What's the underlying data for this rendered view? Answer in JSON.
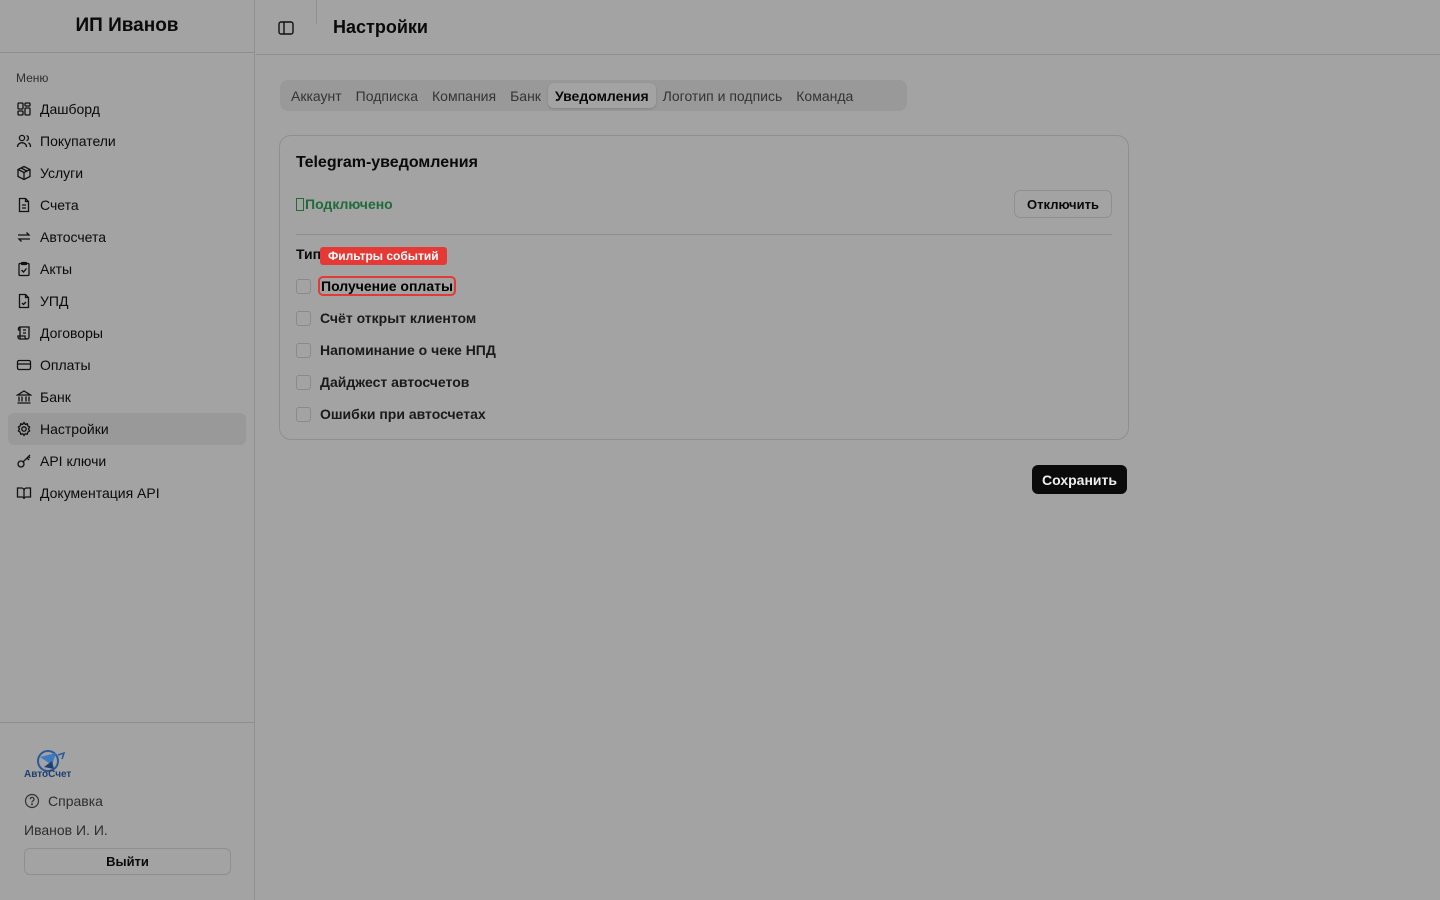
{
  "sidebar": {
    "brand": "ИП Иванов",
    "menu_label": "Меню",
    "items": [
      {
        "label": "Дашборд",
        "icon": "dashboard-icon"
      },
      {
        "label": "Покупатели",
        "icon": "users-icon"
      },
      {
        "label": "Услуги",
        "icon": "package-icon"
      },
      {
        "label": "Счета",
        "icon": "file-icon"
      },
      {
        "label": "Автосчета",
        "icon": "repeat-icon"
      },
      {
        "label": "Акты",
        "icon": "clipboard-check-icon"
      },
      {
        "label": "УПД",
        "icon": "file-check-icon"
      },
      {
        "label": "Договоры",
        "icon": "scroll-icon"
      },
      {
        "label": "Оплаты",
        "icon": "credit-card-icon"
      },
      {
        "label": "Банк",
        "icon": "bank-icon"
      },
      {
        "label": "Настройки",
        "icon": "gear-icon"
      },
      {
        "label": "API ключи",
        "icon": "key-icon"
      },
      {
        "label": "Документация API",
        "icon": "book-icon"
      }
    ],
    "logo_text": "АвтоСчет",
    "help": "Справка",
    "user": "Иванов И. И.",
    "logout": "Выйти"
  },
  "header": {
    "title": "Настройки"
  },
  "tabs": [
    "Аккаунт",
    "Подписка",
    "Компания",
    "Банк",
    "Уведомления",
    "Логотип и подпись",
    "Команда"
  ],
  "active_tab": "Уведомления",
  "telegram": {
    "title": "Telegram-уведомления",
    "status": "Подключено",
    "disconnect": "Отключить",
    "types_label": "Тип",
    "tooltip": "Фильтры событий",
    "options": [
      "Получение оплаты",
      "Счёт открыт клиентом",
      "Напоминание о чеке НПД",
      "Дайджест автосчетов",
      "Ошибки при автосчетах"
    ]
  },
  "save": "Сохранить",
  "colors": {
    "background": "#a3a3a3",
    "status_green": "#1f6b3a",
    "highlight_red": "#e53935",
    "primary_button": "#0a0a0a"
  }
}
